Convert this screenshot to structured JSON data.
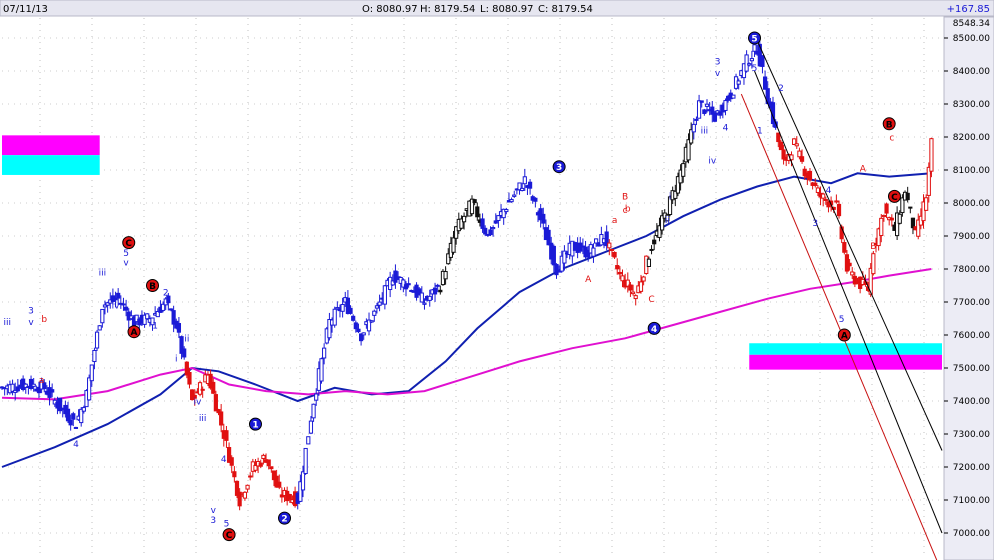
{
  "header": {
    "date": "07/11/13",
    "open": "O: 8080.97",
    "high": "H: 8179.54",
    "low": "L: 8080.97",
    "close": "C: 8179.54",
    "change": "+167.85"
  },
  "colors": {
    "background": "#ffffff",
    "header_bg": "#e6e6f0",
    "axis_panel": "#ececf5",
    "up_wave": "#1a1ad6",
    "down_wave": "#e01010",
    "neutral": "#101010",
    "ma_short": "#1020b0",
    "ma_long": "#e010d0",
    "channel_black": "#000000",
    "channel_red": "#c81010",
    "zone_magenta": "#ff00ff",
    "zone_cyan": "#00ffff"
  },
  "chart_data": {
    "type": "candlestick",
    "title": "",
    "ylim": [
      6960,
      8560
    ],
    "y_ticks": [
      "7000.00",
      "7100.00",
      "7200.00",
      "7300.00",
      "7400.00",
      "7500.00",
      "7600.00",
      "7700.00",
      "7800.00",
      "7900.00",
      "8000.00",
      "8100.00",
      "8200.00",
      "8300.00",
      "8400.00",
      "8500.00"
    ],
    "y_tick_values": [
      7000,
      7100,
      7200,
      7300,
      7400,
      7500,
      7600,
      7700,
      7800,
      7900,
      8000,
      8100,
      8200,
      8300,
      8400,
      8500
    ],
    "top_value_label": "8548.34",
    "top_value": 8548,
    "grid": true,
    "bar_count": 270,
    "close_path": [
      [
        0,
        7440
      ],
      [
        10,
        7450
      ],
      [
        16,
        7440
      ],
      [
        22,
        7380
      ],
      [
        28,
        7330
      ],
      [
        32,
        7420
      ],
      [
        38,
        7690
      ],
      [
        44,
        7710
      ],
      [
        50,
        7640
      ],
      [
        56,
        7650
      ],
      [
        62,
        7700
      ],
      [
        66,
        7630
      ],
      [
        72,
        7400
      ],
      [
        78,
        7480
      ],
      [
        84,
        7300
      ],
      [
        90,
        7100
      ],
      [
        95,
        7200
      ],
      [
        100,
        7230
      ],
      [
        105,
        7120
      ],
      [
        112,
        7100
      ],
      [
        118,
        7400
      ],
      [
        124,
        7640
      ],
      [
        130,
        7700
      ],
      [
        136,
        7600
      ],
      [
        142,
        7680
      ],
      [
        148,
        7780
      ],
      [
        154,
        7750
      ],
      [
        160,
        7700
      ],
      [
        166,
        7750
      ],
      [
        172,
        7920
      ],
      [
        178,
        8000
      ],
      [
        184,
        7900
      ],
      [
        190,
        7980
      ],
      [
        198,
        8070
      ],
      [
        204,
        7950
      ],
      [
        210,
        7800
      ],
      [
        216,
        7870
      ],
      [
        222,
        7850
      ],
      [
        228,
        7900
      ],
      [
        234,
        7780
      ],
      [
        240,
        7720
      ],
      [
        246,
        7870
      ],
      [
        252,
        7980
      ],
      [
        258,
        8120
      ],
      [
        264,
        8300
      ],
      [
        270,
        8260
      ],
      [
        276,
        8330
      ],
      [
        282,
        8430
      ],
      [
        286,
        8470
      ],
      [
        290,
        8320
      ],
      [
        296,
        8120
      ],
      [
        300,
        8180
      ],
      [
        304,
        8100
      ],
      [
        310,
        8020
      ],
      [
        316,
        7990
      ],
      [
        320,
        7800
      ],
      [
        324,
        7760
      ],
      [
        328,
        7740
      ],
      [
        330,
        7860
      ],
      [
        334,
        7980
      ],
      [
        338,
        7920
      ],
      [
        342,
        8040
      ],
      [
        346,
        7900
      ],
      [
        350,
        8020
      ],
      [
        352,
        8180
      ]
    ],
    "wave_colors": [
      [
        0,
        50,
        "blue"
      ],
      [
        50,
        70,
        "blue"
      ],
      [
        70,
        112,
        "red"
      ],
      [
        112,
        166,
        "blue"
      ],
      [
        166,
        182,
        "black"
      ],
      [
        182,
        230,
        "blue"
      ],
      [
        230,
        245,
        "red"
      ],
      [
        245,
        262,
        "black"
      ],
      [
        262,
        294,
        "blue"
      ],
      [
        294,
        328,
        "red"
      ],
      [
        328,
        338,
        "red"
      ],
      [
        338,
        346,
        "black"
      ],
      [
        346,
        352,
        "red"
      ]
    ],
    "series": [
      {
        "name": "",
        "color": "#1020b0",
        "points": [
          [
            0,
            7200
          ],
          [
            20,
            7260
          ],
          [
            40,
            7330
          ],
          [
            60,
            7420
          ],
          [
            72,
            7500
          ],
          [
            82,
            7490
          ],
          [
            96,
            7450
          ],
          [
            112,
            7400
          ],
          [
            126,
            7440
          ],
          [
            140,
            7420
          ],
          [
            154,
            7430
          ],
          [
            168,
            7520
          ],
          [
            180,
            7620
          ],
          [
            196,
            7730
          ],
          [
            212,
            7800
          ],
          [
            228,
            7850
          ],
          [
            244,
            7900
          ],
          [
            258,
            7960
          ],
          [
            272,
            8010
          ],
          [
            286,
            8050
          ],
          [
            300,
            8080
          ],
          [
            314,
            8060
          ],
          [
            324,
            8090
          ],
          [
            336,
            8080
          ],
          [
            352,
            8090
          ]
        ]
      },
      {
        "name": "",
        "color": "#e010d0",
        "points": [
          [
            0,
            7410
          ],
          [
            20,
            7405
          ],
          [
            40,
            7430
          ],
          [
            60,
            7480
          ],
          [
            72,
            7500
          ],
          [
            86,
            7450
          ],
          [
            100,
            7430
          ],
          [
            116,
            7420
          ],
          [
            130,
            7430
          ],
          [
            146,
            7420
          ],
          [
            160,
            7430
          ],
          [
            176,
            7470
          ],
          [
            196,
            7520
          ],
          [
            216,
            7560
          ],
          [
            236,
            7590
          ],
          [
            254,
            7630
          ],
          [
            272,
            7670
          ],
          [
            290,
            7710
          ],
          [
            306,
            7740
          ],
          [
            322,
            7760
          ],
          [
            336,
            7780
          ],
          [
            352,
            7800
          ]
        ]
      }
    ],
    "zones": [
      {
        "color": "magenta",
        "from_bar": 0,
        "to_bar": 37,
        "y_low": 8145,
        "y_high": 8205
      },
      {
        "color": "cyan",
        "from_bar": 0,
        "to_bar": 37,
        "y_low": 8085,
        "y_high": 8145
      },
      {
        "color": "cyan",
        "from_bar": 283,
        "to_bar": 356,
        "y_low": 7540,
        "y_high": 7575
      },
      {
        "color": "magenta",
        "from_bar": 283,
        "to_bar": 356,
        "y_low": 7495,
        "y_high": 7540
      }
    ],
    "channel_lines": [
      {
        "color": "black",
        "from": [
          285,
          8510
        ],
        "to": [
          356,
          7250
        ]
      },
      {
        "color": "black",
        "from": [
          285,
          8400
        ],
        "to": [
          356,
          7000
        ]
      },
      {
        "color": "red",
        "from": [
          280,
          8330
        ],
        "to": [
          356,
          6880
        ]
      }
    ],
    "annotations": [
      {
        "text": "iii",
        "bar": 2,
        "value": 7630,
        "color": "blue"
      },
      {
        "text": "3",
        "bar": 11,
        "value": 7665,
        "color": "blue"
      },
      {
        "text": "v",
        "bar": 11,
        "value": 7630,
        "color": "blue"
      },
      {
        "text": "b",
        "bar": 16,
        "value": 7640,
        "color": "red"
      },
      {
        "text": "a",
        "bar": 15,
        "value": 7455,
        "color": "red"
      },
      {
        "text": "4",
        "bar": 28,
        "value": 7260,
        "color": "blue"
      },
      {
        "text": "5",
        "bar": 47,
        "value": 7840,
        "color": "blue"
      },
      {
        "text": "v",
        "bar": 47,
        "value": 7810,
        "color": "blue"
      },
      {
        "text": "iii",
        "bar": 38,
        "value": 7780,
        "color": "blue"
      },
      {
        "text": "iv",
        "bar": 43,
        "value": 7680,
        "color": "blue"
      },
      {
        "text": "2",
        "bar": 62,
        "value": 7720,
        "color": "blue"
      },
      {
        "text": "1",
        "bar": 58,
        "value": 7620,
        "color": "blue"
      },
      {
        "text": "ii",
        "bar": 70,
        "value": 7580,
        "color": "blue"
      },
      {
        "text": "i",
        "bar": 66,
        "value": 7520,
        "color": "blue"
      },
      {
        "text": "iii",
        "bar": 76,
        "value": 7340,
        "color": "blue"
      },
      {
        "text": "iv",
        "bar": 74,
        "value": 7390,
        "color": "blue"
      },
      {
        "text": "4",
        "bar": 84,
        "value": 7215,
        "color": "blue"
      },
      {
        "text": "v",
        "bar": 80,
        "value": 7060,
        "color": "blue"
      },
      {
        "text": "3",
        "bar": 80,
        "value": 7030,
        "color": "blue"
      },
      {
        "text": "5",
        "bar": 85,
        "value": 7020,
        "color": "blue"
      },
      {
        "text": "a",
        "bar": 232,
        "value": 7940,
        "color": "red"
      },
      {
        "text": "b",
        "bar": 237,
        "value": 7975,
        "color": "red"
      },
      {
        "text": "B",
        "bar": 236,
        "value": 8010,
        "color": "red"
      },
      {
        "text": "c",
        "bar": 236,
        "value": 7970,
        "color": "red"
      },
      {
        "text": "A",
        "bar": 222,
        "value": 7760,
        "color": "red"
      },
      {
        "text": "C",
        "bar": 246,
        "value": 7700,
        "color": "red"
      },
      {
        "text": "i",
        "bar": 253,
        "value": 8010,
        "color": "blue"
      },
      {
        "text": "ii",
        "bar": 252,
        "value": 7940,
        "color": "blue"
      },
      {
        "text": "iii",
        "bar": 266,
        "value": 8210,
        "color": "blue"
      },
      {
        "text": "iv",
        "bar": 269,
        "value": 8120,
        "color": "blue"
      },
      {
        "text": "4",
        "bar": 274,
        "value": 8220,
        "color": "blue"
      },
      {
        "text": "3",
        "bar": 271,
        "value": 8420,
        "color": "blue"
      },
      {
        "text": "v",
        "bar": 271,
        "value": 8385,
        "color": "blue"
      },
      {
        "text": "5",
        "bar": 285,
        "value": 8400,
        "color": "blue"
      },
      {
        "text": "1",
        "bar": 287,
        "value": 8210,
        "color": "blue"
      },
      {
        "text": "2",
        "bar": 295,
        "value": 8340,
        "color": "blue"
      },
      {
        "text": "3",
        "bar": 308,
        "value": 7930,
        "color": "blue"
      },
      {
        "text": "4",
        "bar": 313,
        "value": 8030,
        "color": "blue"
      },
      {
        "text": "5",
        "bar": 318,
        "value": 7640,
        "color": "blue"
      },
      {
        "text": "A",
        "bar": 326,
        "value": 8095,
        "color": "red"
      },
      {
        "text": "B",
        "bar": 330,
        "value": 7860,
        "color": "red"
      },
      {
        "text": "c",
        "bar": 337,
        "value": 8190,
        "color": "red"
      }
    ],
    "circled_labels": [
      {
        "text": "C",
        "bar": 48,
        "value": 7880,
        "style": "red"
      },
      {
        "text": "B",
        "bar": 57,
        "value": 7750,
        "style": "red"
      },
      {
        "text": "A",
        "bar": 50,
        "value": 7610,
        "style": "red"
      },
      {
        "text": "C",
        "bar": 86,
        "value": 6995,
        "style": "red"
      },
      {
        "text": "1",
        "bar": 96,
        "value": 7330,
        "style": "blue"
      },
      {
        "text": "2",
        "bar": 107,
        "value": 7045,
        "style": "blue"
      },
      {
        "text": "3",
        "bar": 211,
        "value": 8110,
        "style": "blue"
      },
      {
        "text": "4",
        "bar": 247,
        "value": 7620,
        "style": "blue"
      },
      {
        "text": "5",
        "bar": 285,
        "value": 8500,
        "style": "blue"
      },
      {
        "text": "A",
        "bar": 319,
        "value": 7600,
        "style": "red"
      },
      {
        "text": "B",
        "bar": 336,
        "value": 8240,
        "style": "red"
      },
      {
        "text": "C",
        "bar": 338,
        "value": 8020,
        "style": "red"
      }
    ]
  }
}
